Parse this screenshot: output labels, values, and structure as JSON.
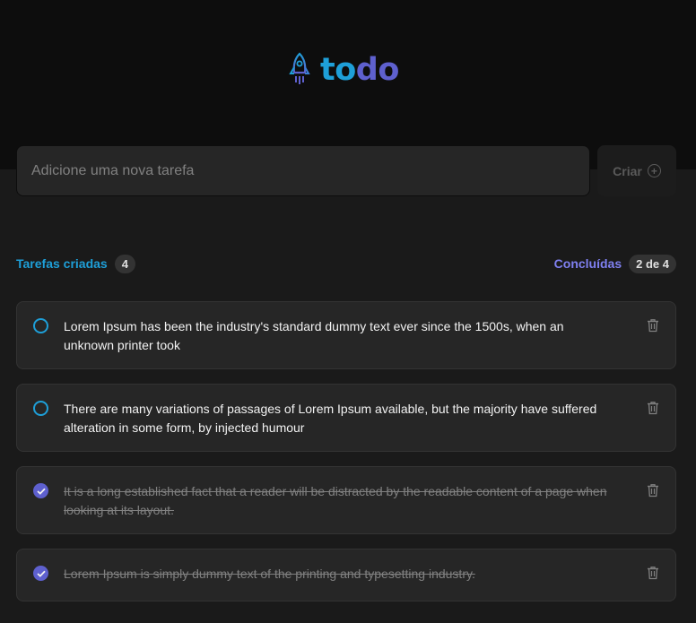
{
  "app": {
    "logo_part1": "to",
    "logo_part2": "do",
    "logo_icon": "rocket-icon"
  },
  "new_task": {
    "placeholder": "Adicione uma nova tarefa",
    "value": "",
    "create_label": "Criar",
    "create_icon": "plus-circle-icon"
  },
  "summary": {
    "created_label": "Tarefas criadas",
    "created_count": "4",
    "done_label": "Concluídas",
    "done_count": "2 de 4"
  },
  "colors": {
    "blue": "#1e9fd8",
    "purple": "#5e60ce",
    "purple_light": "#7f80f0"
  },
  "tasks": [
    {
      "text": "Lorem Ipsum has been the industry's standard dummy text ever since the 1500s, when an unknown printer took",
      "done": false
    },
    {
      "text": "There are many variations of passages of Lorem Ipsum available, but the majority have suffered alteration in some form, by injected humour",
      "done": false
    },
    {
      "text": "It is a long established fact that a reader will be distracted by the readable content of a page when looking at its layout.",
      "done": true
    },
    {
      "text": "Lorem Ipsum is simply dummy text of the printing and typesetting industry.",
      "done": true
    }
  ]
}
